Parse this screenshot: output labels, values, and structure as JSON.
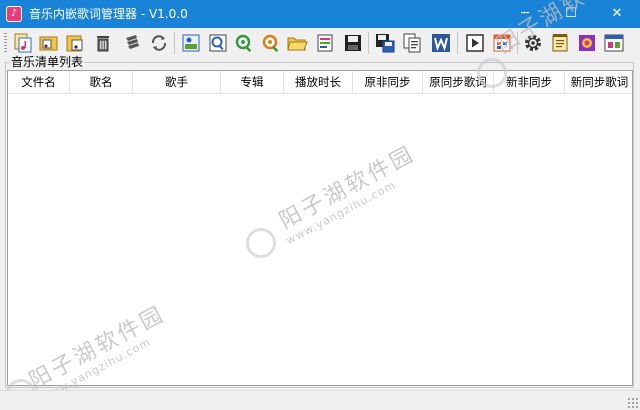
{
  "window": {
    "title": "音乐内嵌歌词管理器 - V1.0.0",
    "app_icon_glyph": "♪",
    "minimize_glyph": "─",
    "maximize_glyph": "☐",
    "close_glyph": "✕",
    "titlebar_color": "#1883d7"
  },
  "toolbar": {
    "buttons": [
      {
        "name": "add-files-button",
        "icon": "music-file-add-icon"
      },
      {
        "name": "add-folder-button",
        "icon": "folder-add-icon"
      },
      {
        "name": "import-button",
        "icon": "import-icon"
      },
      {
        "name": "delete-button",
        "icon": "trash-icon"
      },
      {
        "name": "clear-button",
        "icon": "broom-icon"
      },
      {
        "name": "refresh-button",
        "icon": "refresh-icon"
      },
      {
        "name": "edit-tags-button",
        "icon": "tag-edit-icon"
      },
      {
        "name": "search-button",
        "icon": "magnifier-icon"
      },
      {
        "name": "search-green-button",
        "icon": "search-green-icon"
      },
      {
        "name": "search-orange-button",
        "icon": "search-orange-icon"
      },
      {
        "name": "open-folder-button",
        "icon": "folder-open-icon"
      },
      {
        "name": "lyrics-button",
        "icon": "lyrics-doc-icon"
      },
      {
        "name": "save-button",
        "icon": "floppy-icon"
      },
      {
        "name": "save-as-button",
        "icon": "floppy-multi-icon"
      },
      {
        "name": "copy-button",
        "icon": "copy-icon"
      },
      {
        "name": "word-export-button",
        "icon": "word-icon"
      },
      {
        "name": "play-button",
        "icon": "play-icon"
      },
      {
        "name": "sync-button",
        "icon": "sync-icon"
      },
      {
        "name": "settings-button",
        "icon": "gear-icon"
      },
      {
        "name": "notes-button",
        "icon": "notepad-icon"
      },
      {
        "name": "image-button",
        "icon": "image-icon"
      },
      {
        "name": "about-button",
        "icon": "about-icon"
      }
    ]
  },
  "group": {
    "label": "音乐清单列表"
  },
  "table": {
    "columns": [
      "文件名",
      "歌名",
      "歌手",
      "专辑",
      "播放时长",
      "原非同步",
      "原同步歌词",
      "新非同步",
      "新同步歌词"
    ],
    "rows": []
  },
  "watermark": {
    "text": "阳子湖软件园",
    "url": "www.yangzihu.com"
  }
}
